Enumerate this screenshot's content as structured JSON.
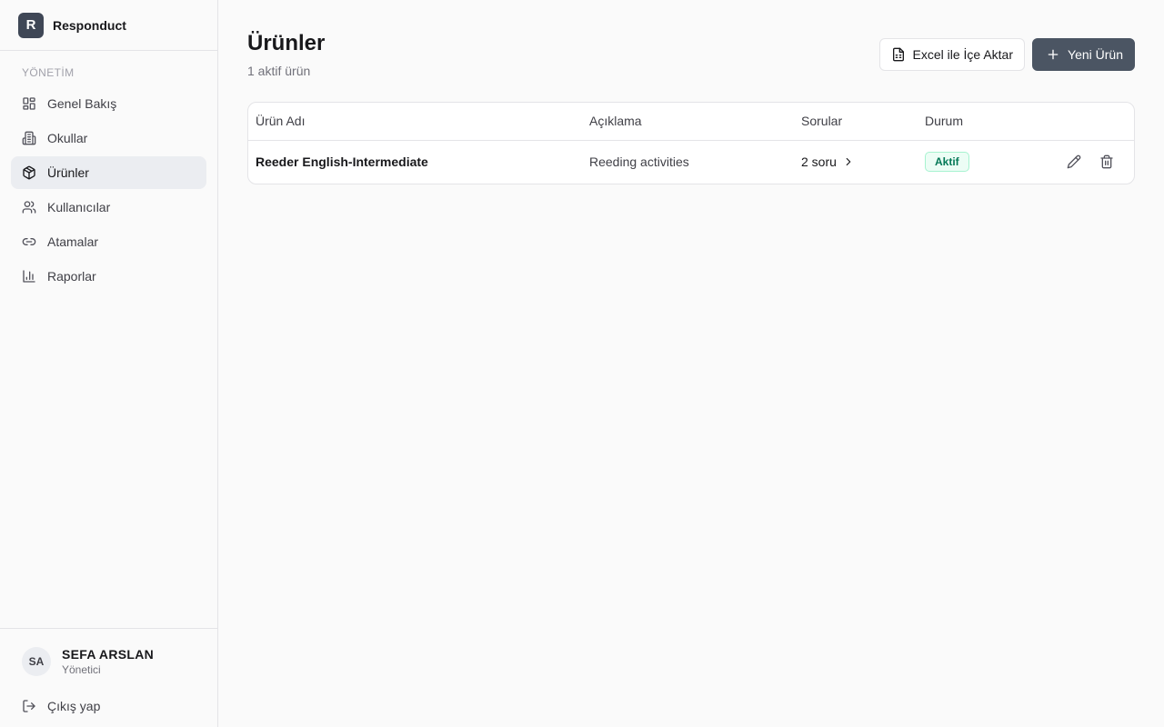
{
  "app": {
    "logo_letter": "R",
    "name": "Responduct"
  },
  "sidebar": {
    "section_label": "YÖNETİM",
    "items": [
      {
        "label": "Genel Bakış",
        "icon": "dashboard-icon",
        "active": false
      },
      {
        "label": "Okullar",
        "icon": "school-icon",
        "active": false
      },
      {
        "label": "Ürünler",
        "icon": "package-icon",
        "active": true
      },
      {
        "label": "Kullanıcılar",
        "icon": "users-icon",
        "active": false
      },
      {
        "label": "Atamalar",
        "icon": "link-icon",
        "active": false
      },
      {
        "label": "Raporlar",
        "icon": "bar-chart-icon",
        "active": false
      }
    ]
  },
  "user": {
    "initials": "SA",
    "name": "SEFA ARSLAN",
    "role": "Yönetici",
    "logout_label": "Çıkış yap"
  },
  "page": {
    "title": "Ürünler",
    "subtitle": "1 aktif ürün",
    "import_button": "Excel ile İçe Aktar",
    "new_button": "Yeni Ürün"
  },
  "table": {
    "columns": [
      "Ürün Adı",
      "Açıklama",
      "Sorular",
      "Durum"
    ],
    "rows": [
      {
        "name": "Reeder English-Intermediate",
        "description": "Reeding activities",
        "questions": "2 soru",
        "status": "Aktif"
      }
    ]
  },
  "colors": {
    "primary": "#4b5563",
    "brand": "#3f4756",
    "active_bg": "#ebedf1",
    "success": "#047857"
  }
}
